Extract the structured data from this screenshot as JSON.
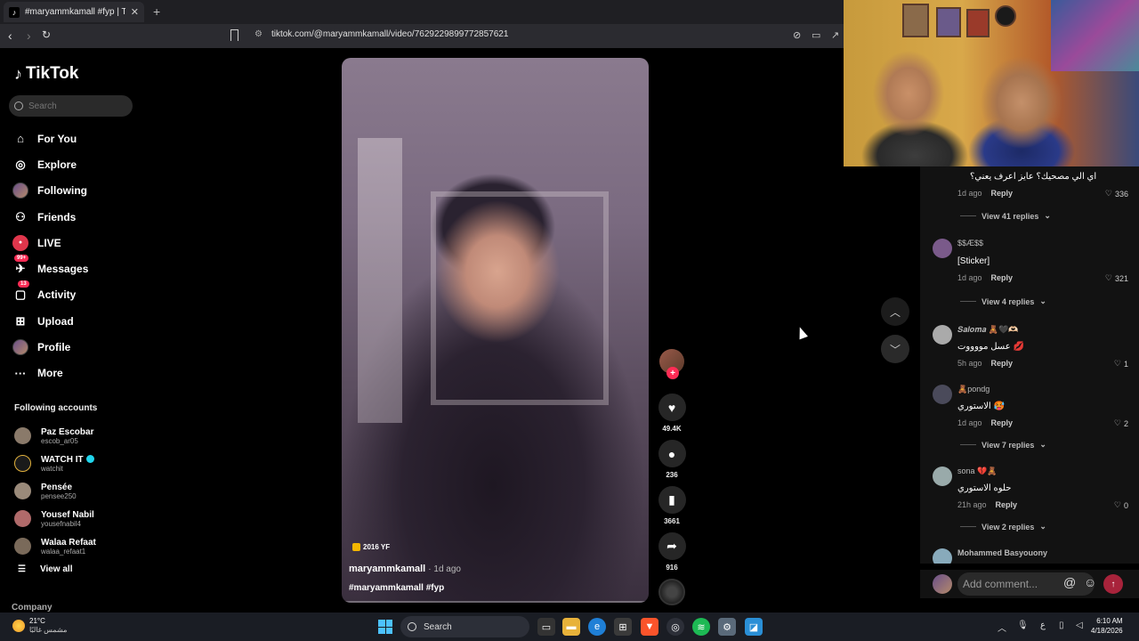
{
  "browser": {
    "tab_title": "#maryammkamall #fyp | TikTok",
    "new_tab": "+",
    "close": "✕",
    "url": "tiktok.com/@maryammkamall/video/7629229899772857621"
  },
  "sidebar": {
    "logo": "TikTok",
    "search_placeholder": "Search",
    "nav": [
      {
        "label": "For You",
        "icon": "home-icon"
      },
      {
        "label": "Explore",
        "icon": "compass-icon"
      },
      {
        "label": "Following",
        "icon": "following-avatar-icon"
      },
      {
        "label": "Friends",
        "icon": "friends-icon"
      },
      {
        "label": "LIVE",
        "icon": "live-icon"
      },
      {
        "label": "Messages",
        "icon": "messages-icon",
        "badge": "99+"
      },
      {
        "label": "Activity",
        "icon": "activity-icon",
        "badge": "13"
      },
      {
        "label": "Upload",
        "icon": "upload-icon"
      },
      {
        "label": "Profile",
        "icon": "profile-avatar-icon"
      },
      {
        "label": "More",
        "icon": "more-icon"
      }
    ],
    "following_title": "Following accounts",
    "accounts": [
      {
        "name": "Paz Escobar",
        "handle": "escob_ar05",
        "verified": false
      },
      {
        "name": "WATCH IT",
        "handle": "watchit",
        "verified": true
      },
      {
        "name": "Pensée",
        "handle": "pensee250",
        "verified": false
      },
      {
        "name": "Yousef Nabil",
        "handle": "yousefnabil4",
        "verified": false
      },
      {
        "name": "Walaa Refaat",
        "handle": "walaa_refaat1",
        "verified": false
      }
    ],
    "view_all": "View all",
    "company": "Company"
  },
  "video": {
    "label": "2016 YF",
    "author": "maryammkamall",
    "time": "· 1d ago",
    "tags": "#maryammkamall #fyp"
  },
  "actions": {
    "likes": "49.4K",
    "comments": "236",
    "saves": "3661",
    "shares": "916"
  },
  "comments": [
    {
      "user": "",
      "text": "اي الي مصحيك؟ عايز اعرف يعني؟",
      "ago": "1d ago",
      "reply": "Reply",
      "likes": "336",
      "view_replies": "View 41 replies"
    },
    {
      "user": "$$Æ$$",
      "text": "[Sticker]",
      "ago": "1d ago",
      "reply": "Reply",
      "likes": "321",
      "view_replies": "View 4 replies"
    },
    {
      "user": "𝑺𝒂𝒍𝒐𝒎𝒂 🧸🖤🫶🏻",
      "text": "عسل مووووت 💋",
      "ago": "5h ago",
      "reply": "Reply",
      "likes": "1",
      "view_replies": ""
    },
    {
      "user": "🧸pondg",
      "text": "الاستوري 🥵",
      "ago": "1d ago",
      "reply": "Reply",
      "likes": "2",
      "view_replies": "View 7 replies"
    },
    {
      "user": "sona 💔🧸",
      "text": "حلوه الاستوري",
      "ago": "21h ago",
      "reply": "Reply",
      "likes": "0",
      "view_replies": "View 2 replies"
    },
    {
      "user": "Mohammed Basyouony",
      "text": "",
      "ago": "",
      "reply": "",
      "likes": "",
      "view_replies": ""
    }
  ],
  "comment_input": {
    "placeholder": "Add comment..."
  },
  "taskbar": {
    "temp": "21°C",
    "condition": "مشمس غالبًا",
    "search": "Search",
    "time": "6:10 AM",
    "date": "4/18/2026",
    "lang": "ع"
  }
}
